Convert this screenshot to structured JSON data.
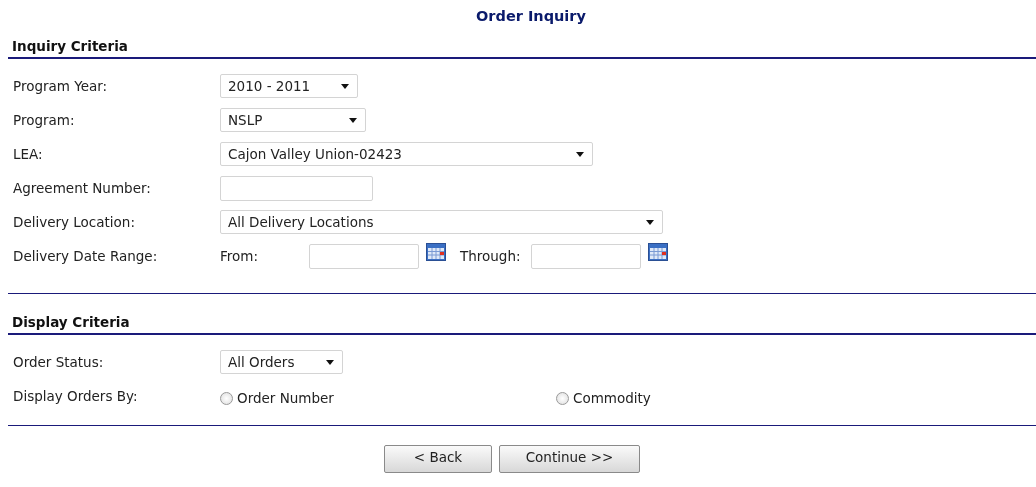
{
  "title": "Order Inquiry",
  "sections": [
    {
      "title": "Inquiry Criteria",
      "fields": [
        {
          "kind": "select",
          "label": "Program Year:",
          "value": "2010 - 2011"
        },
        {
          "kind": "select",
          "label": "Program:",
          "value": "NSLP"
        },
        {
          "kind": "select",
          "label": "LEA:",
          "value": "Cajon Valley Union-02423"
        },
        {
          "kind": "text",
          "label": "Agreement Number:"
        },
        {
          "kind": "select",
          "label": "Delivery Location:",
          "value": "All Delivery Locations"
        },
        {
          "kind": "daterange",
          "label": "Delivery Date Range:",
          "from_label": "From:",
          "through_label": "Through:"
        }
      ]
    },
    {
      "title": "Display Criteria",
      "fields": [
        {
          "kind": "select",
          "label": "Order Status:",
          "value": "All Orders"
        },
        {
          "kind": "radio",
          "label": "Display Orders By:",
          "options": [
            {
              "label": "Order Number",
              "selected": false
            },
            {
              "label": "Commodity",
              "selected": false
            }
          ]
        }
      ]
    }
  ],
  "buttons": [
    "< Back",
    "Continue >>"
  ]
}
